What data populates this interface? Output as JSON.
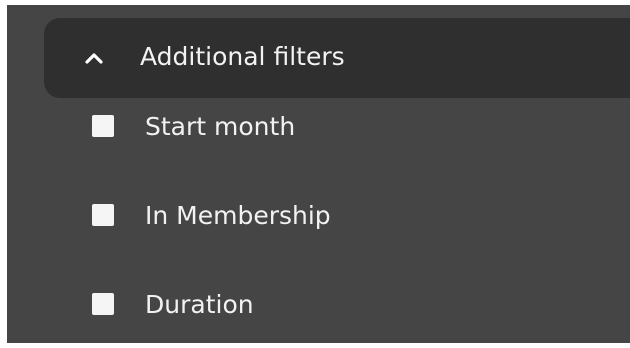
{
  "filters": {
    "header": {
      "label": "Additional filters",
      "icon": "chevron-up-icon",
      "expanded": true
    },
    "options": [
      {
        "label": "Start month",
        "checked": false
      },
      {
        "label": "In Membership",
        "checked": false
      },
      {
        "label": "Duration",
        "checked": false
      }
    ]
  },
  "colors": {
    "panel_bg": "#454545",
    "header_bg": "#2f2f2f",
    "text": "#f2f2f2",
    "checkbox": "#f5f5f5"
  }
}
